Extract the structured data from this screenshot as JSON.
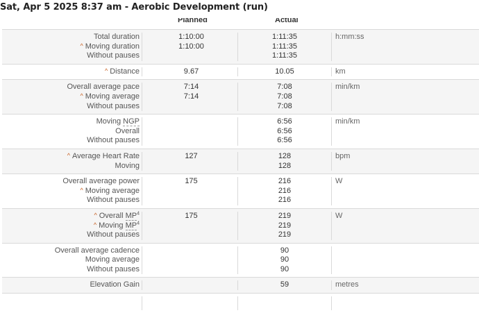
{
  "title": "Sat, Apr 5 2025 8:37 am - Aerobic Development (run)",
  "columns": {
    "planned": "Planned",
    "actual": "Actual"
  },
  "caret": "^",
  "rows": [
    {
      "labels": [
        {
          "text": "Total duration"
        },
        {
          "text": "Moving duration",
          "caret": true
        },
        {
          "text": "Without pauses"
        }
      ],
      "planned": [
        "1:10:00",
        "1:10:00"
      ],
      "actual": [
        "1:11:35",
        "1:11:35",
        "1:11:35"
      ],
      "unit": "h:mm:ss"
    },
    {
      "labels": [
        {
          "text": "Distance",
          "caret": true
        }
      ],
      "planned": [
        "9.67"
      ],
      "actual": [
        "10.05"
      ],
      "unit": "km"
    },
    {
      "labels": [
        {
          "text": "Overall average pace"
        },
        {
          "text": "Moving average",
          "caret": true
        },
        {
          "text": "Without pauses"
        }
      ],
      "planned": [
        "7:14",
        "7:14"
      ],
      "actual": [
        "7:08",
        "7:08",
        "7:08"
      ],
      "unit": "min/km"
    },
    {
      "labels": [
        {
          "text": "Moving ",
          "abbr": "NGP"
        },
        {
          "text": "Overall"
        },
        {
          "text": "Without pauses"
        }
      ],
      "planned": [],
      "actual": [
        "6:56",
        "6:56",
        "6:56"
      ],
      "unit": "min/km"
    },
    {
      "labels": [
        {
          "text": "Average Heart Rate",
          "caret": true
        },
        {
          "text": "Moving"
        }
      ],
      "planned": [
        "127"
      ],
      "actual": [
        "128",
        "128"
      ],
      "unit": "bpm"
    },
    {
      "labels": [
        {
          "text": "Overall average power"
        },
        {
          "text": "Moving average",
          "caret": true
        },
        {
          "text": "Without pauses"
        }
      ],
      "planned": [
        "175"
      ],
      "actual": [
        "216",
        "216",
        "216"
      ],
      "unit": "W"
    },
    {
      "labels": [
        {
          "text": "Overall ",
          "abbr": "MP",
          "sup": "4",
          "caret": true
        },
        {
          "text": "Moving ",
          "abbr": "MP",
          "sup": "4",
          "caret": true
        },
        {
          "text": "Without pauses"
        }
      ],
      "planned": [
        "175"
      ],
      "actual": [
        "219",
        "219",
        "219"
      ],
      "unit": "W"
    },
    {
      "labels": [
        {
          "text": "Overall average cadence"
        },
        {
          "text": "Moving average"
        },
        {
          "text": "Without pauses"
        }
      ],
      "planned": [],
      "actual": [
        "90",
        "90",
        "90"
      ],
      "unit": ""
    },
    {
      "labels": [
        {
          "text": "Elevation Gain"
        }
      ],
      "planned": [],
      "actual": [
        "59"
      ],
      "unit": "metres"
    },
    {
      "labels": [
        {
          "text": ""
        }
      ],
      "planned": [],
      "actual": [],
      "unit": ""
    }
  ]
}
